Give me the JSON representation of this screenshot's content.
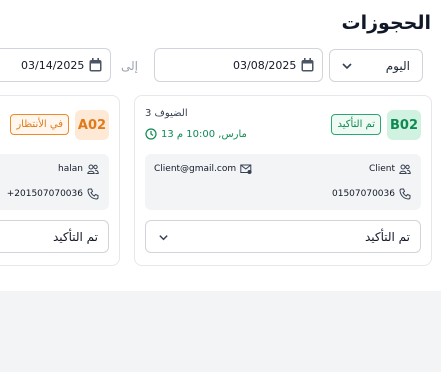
{
  "header": {
    "title": "الحجوزات"
  },
  "filters": {
    "period": "اليوم",
    "date_from": "03/08/2025",
    "to_label": "إلى",
    "date_to": "03/14/2025"
  },
  "bookings": [
    {
      "code": "B02",
      "status": "تم التأكيد",
      "guests": "3 الضيوف",
      "datetime": "13 مارس, 10:00 م",
      "client_name": "Client",
      "client_email": "Client@gmail.com",
      "client_phone": "01507070036",
      "status_select": "تم التأكيد"
    },
    {
      "code": "A02",
      "status": "في الأنتظار",
      "client_name": "halan",
      "client_phone": "+201507070036",
      "status_select": "تم التأكيد"
    }
  ],
  "colors": {
    "confirmed": "#0f8a54",
    "pending": "#e07a1a"
  }
}
